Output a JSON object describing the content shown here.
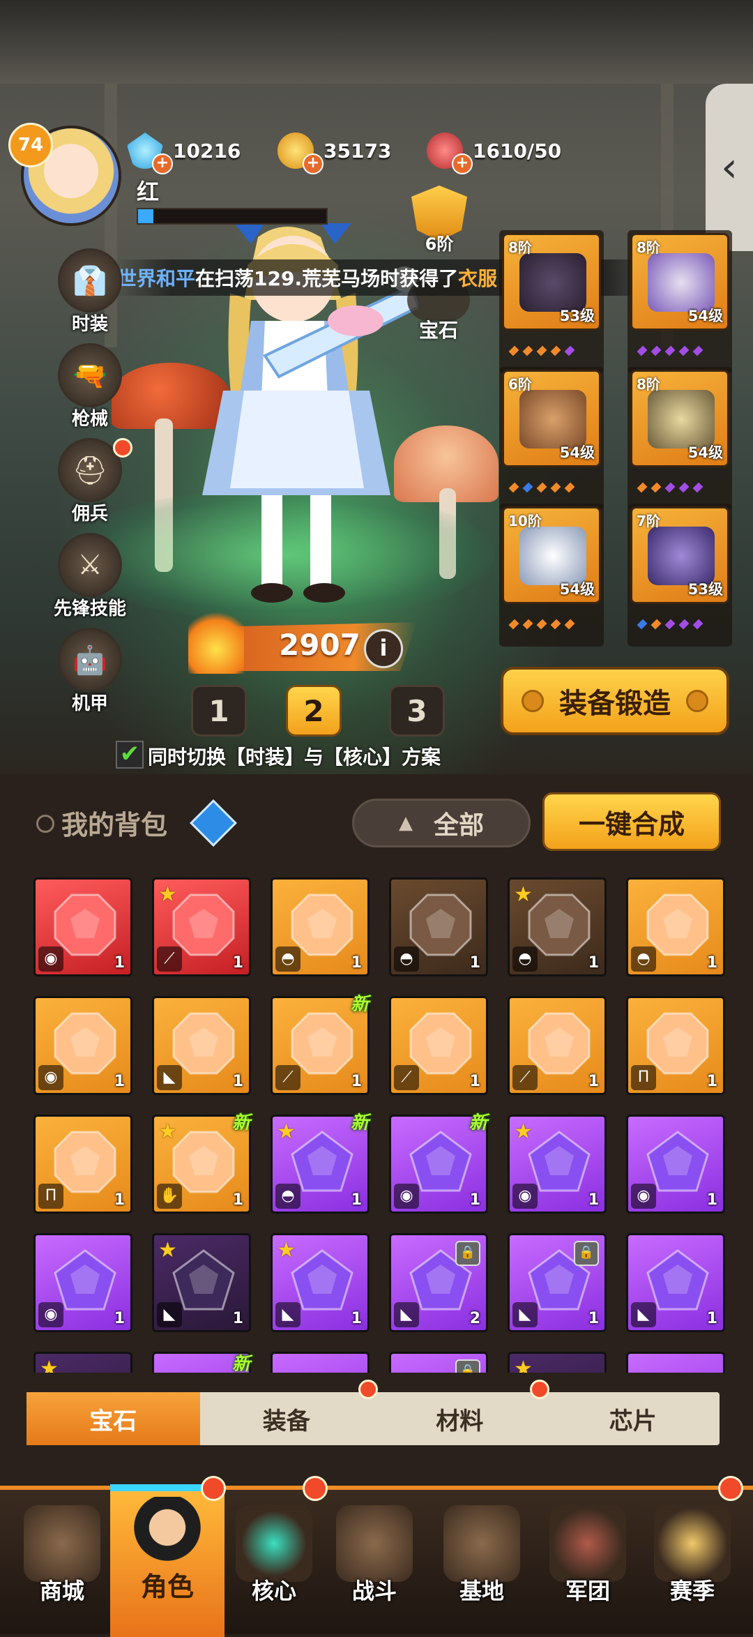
{
  "player": {
    "level": "74",
    "name": "红"
  },
  "resources": [
    {
      "icon": "diamond-icon",
      "value": "10216"
    },
    {
      "icon": "gold-coin-icon",
      "value": "35173"
    },
    {
      "icon": "meat-stamina-icon",
      "value": "1610/50"
    }
  ],
  "rank_badge": {
    "label": "6阶"
  },
  "gem_slot": {
    "label": "宝石"
  },
  "side_menu": [
    {
      "label": "时装",
      "icon": "outfit-icon"
    },
    {
      "label": "枪械",
      "icon": "gun-icon"
    },
    {
      "label": "佣兵",
      "icon": "mercenary-icon"
    },
    {
      "label": "先锋技能",
      "icon": "skill-icon"
    },
    {
      "label": "机甲",
      "icon": "mecha-icon"
    }
  ],
  "broadcast": {
    "player": "世界和平",
    "text": "在扫荡129.荒芜马场时获得了",
    "item": "衣服 · 传说宝"
  },
  "equipment": [
    {
      "tier": "8阶",
      "level": "53级",
      "art": "helmet-icon"
    },
    {
      "tier": "8阶",
      "level": "54级",
      "art": "boots-icon"
    },
    {
      "tier": "6阶",
      "level": "54级",
      "art": "armor-icon"
    },
    {
      "tier": "8阶",
      "level": "54级",
      "art": "pants-icon"
    },
    {
      "tier": "10阶",
      "level": "54级",
      "art": "shoes-icon"
    },
    {
      "tier": "7阶",
      "level": "53级",
      "art": "gloves-icon"
    }
  ],
  "power": {
    "value": "2907"
  },
  "schemes": [
    "1",
    "2",
    "3"
  ],
  "active_scheme": "2",
  "forge_button": "装备锻造",
  "sync_option": {
    "text": "同时切换【时装】与【核心】方案",
    "checked": true
  },
  "bag": {
    "title": "我的背包",
    "filter": "全部",
    "synth_button": "一键合成"
  },
  "grid": [
    {
      "color": "red",
      "star": false,
      "new": false,
      "lock": false,
      "slot": "armor-icon",
      "count": "1"
    },
    {
      "color": "red",
      "star": true,
      "new": false,
      "lock": false,
      "slot": "leg-icon",
      "count": "1"
    },
    {
      "color": "orange",
      "star": false,
      "new": false,
      "lock": false,
      "slot": "helmet-icon",
      "count": "1"
    },
    {
      "color": "dim-orange",
      "star": false,
      "new": false,
      "lock": false,
      "slot": "helmet-icon",
      "count": "1"
    },
    {
      "color": "dim-orange",
      "star": true,
      "new": false,
      "lock": false,
      "slot": "helmet-icon",
      "count": "1"
    },
    {
      "color": "orange",
      "star": false,
      "new": false,
      "lock": false,
      "slot": "helmet-icon",
      "count": "1"
    },
    {
      "color": "orange",
      "star": false,
      "new": false,
      "lock": false,
      "slot": "armor-icon",
      "count": "1"
    },
    {
      "color": "orange",
      "star": false,
      "new": false,
      "lock": false,
      "slot": "boot-icon",
      "count": "1"
    },
    {
      "color": "orange",
      "star": false,
      "new": true,
      "lock": false,
      "slot": "leg-icon",
      "count": "1"
    },
    {
      "color": "orange",
      "star": false,
      "new": false,
      "lock": false,
      "slot": "leg-icon",
      "count": "1"
    },
    {
      "color": "orange",
      "star": false,
      "new": false,
      "lock": false,
      "slot": "leg-icon",
      "count": "1"
    },
    {
      "color": "orange",
      "star": false,
      "new": false,
      "lock": false,
      "slot": "pants-icon",
      "count": "1"
    },
    {
      "color": "orange",
      "star": false,
      "new": false,
      "lock": false,
      "slot": "pants-icon",
      "count": "1"
    },
    {
      "color": "orange",
      "star": true,
      "new": true,
      "lock": false,
      "slot": "glove-icon",
      "count": "1"
    },
    {
      "color": "purple",
      "star": true,
      "new": true,
      "lock": false,
      "slot": "helmet-icon",
      "count": "1"
    },
    {
      "color": "purple",
      "star": false,
      "new": true,
      "lock": false,
      "slot": "armor-icon",
      "count": "1"
    },
    {
      "color": "purple",
      "star": true,
      "new": false,
      "lock": false,
      "slot": "armor-icon",
      "count": "1"
    },
    {
      "color": "purple",
      "star": false,
      "new": false,
      "lock": false,
      "slot": "armor-icon",
      "count": "1"
    },
    {
      "color": "purple",
      "star": false,
      "new": false,
      "lock": false,
      "slot": "armor-icon",
      "count": "1"
    },
    {
      "color": "dim-purple",
      "star": true,
      "new": false,
      "lock": false,
      "slot": "boot-icon",
      "count": "1"
    },
    {
      "color": "purple",
      "star": true,
      "new": false,
      "lock": false,
      "slot": "boot-icon",
      "count": "1"
    },
    {
      "color": "purple",
      "star": false,
      "new": false,
      "lock": true,
      "slot": "boot-icon",
      "count": "2"
    },
    {
      "color": "purple",
      "star": false,
      "new": false,
      "lock": true,
      "slot": "boot-icon",
      "count": "1"
    },
    {
      "color": "purple",
      "star": false,
      "new": false,
      "lock": false,
      "slot": "boot-icon",
      "count": "1"
    }
  ],
  "category_tabs": [
    "宝石",
    "装备",
    "材料",
    "芯片"
  ],
  "active_category": "宝石",
  "bottom_nav": [
    "商城",
    "角色",
    "核心",
    "战斗",
    "基地",
    "军团",
    "赛季"
  ],
  "active_nav": "角色",
  "colors": {
    "accent": "#f3a11b",
    "new": "#aaff33",
    "red_dot": "#f04a2a"
  }
}
